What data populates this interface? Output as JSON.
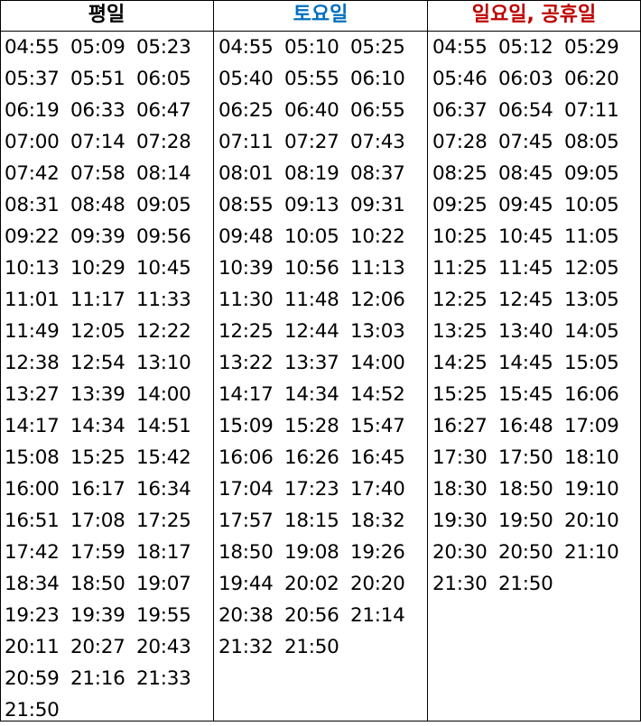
{
  "timetable": {
    "headers": [
      {
        "label": "평일",
        "color": "#000000"
      },
      {
        "label": "토요일",
        "color": "#0070C0"
      },
      {
        "label": "일요일, 공휴일",
        "color": "#C00000"
      }
    ],
    "columns": [
      [
        "04:55",
        "05:09",
        "05:23",
        "05:37",
        "05:51",
        "06:05",
        "06:19",
        "06:33",
        "06:47",
        "07:00",
        "07:14",
        "07:28",
        "07:42",
        "07:58",
        "08:14",
        "08:31",
        "08:48",
        "09:05",
        "09:22",
        "09:39",
        "09:56",
        "10:13",
        "10:29",
        "10:45",
        "11:01",
        "11:17",
        "11:33",
        "11:49",
        "12:05",
        "12:22",
        "12:38",
        "12:54",
        "13:10",
        "13:27",
        "13:39",
        "14:00",
        "14:17",
        "14:34",
        "14:51",
        "15:08",
        "15:25",
        "15:42",
        "16:00",
        "16:17",
        "16:34",
        "16:51",
        "17:08",
        "17:25",
        "17:42",
        "17:59",
        "18:17",
        "18:34",
        "18:50",
        "19:07",
        "19:23",
        "19:39",
        "19:55",
        "20:11",
        "20:27",
        "20:43",
        "20:59",
        "21:16",
        "21:33",
        "21:50"
      ],
      [
        "04:55",
        "05:10",
        "05:25",
        "05:40",
        "05:55",
        "06:10",
        "06:25",
        "06:40",
        "06:55",
        "07:11",
        "07:27",
        "07:43",
        "08:01",
        "08:19",
        "08:37",
        "08:55",
        "09:13",
        "09:31",
        "09:48",
        "10:05",
        "10:22",
        "10:39",
        "10:56",
        "11:13",
        "11:30",
        "11:48",
        "12:06",
        "12:25",
        "12:44",
        "13:03",
        "13:22",
        "13:37",
        "14:00",
        "14:17",
        "14:34",
        "14:52",
        "15:09",
        "15:28",
        "15:47",
        "16:06",
        "16:26",
        "16:45",
        "17:04",
        "17:23",
        "17:40",
        "17:57",
        "18:15",
        "18:32",
        "18:50",
        "19:08",
        "19:26",
        "19:44",
        "20:02",
        "20:20",
        "20:38",
        "20:56",
        "21:14",
        "21:32",
        "21:50"
      ],
      [
        "04:55",
        "05:12",
        "05:29",
        "05:46",
        "06:03",
        "06:20",
        "06:37",
        "06:54",
        "07:11",
        "07:28",
        "07:45",
        "08:05",
        "08:25",
        "08:45",
        "09:05",
        "09:25",
        "09:45",
        "10:05",
        "10:25",
        "10:45",
        "11:05",
        "11:25",
        "11:45",
        "12:05",
        "12:25",
        "12:45",
        "13:05",
        "13:25",
        "13:40",
        "14:05",
        "14:25",
        "14:45",
        "15:05",
        "15:25",
        "15:45",
        "16:06",
        "16:27",
        "16:48",
        "17:09",
        "17:30",
        "17:50",
        "18:10",
        "18:30",
        "18:50",
        "19:10",
        "19:30",
        "19:50",
        "20:10",
        "20:30",
        "20:50",
        "21:10",
        "21:30",
        "21:50"
      ]
    ]
  }
}
